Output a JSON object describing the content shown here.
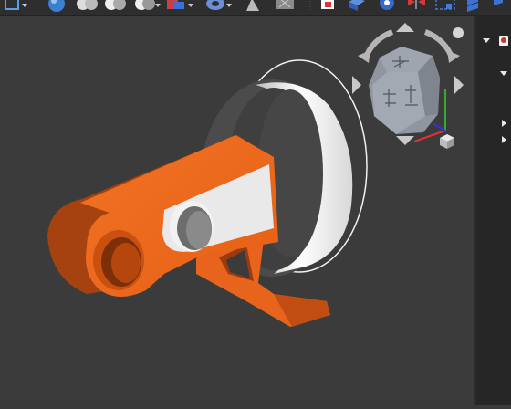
{
  "toolbar": {
    "icons": [
      "select-box-icon",
      "sphere-icon",
      "boolean-union-icon",
      "boolean-cut-icon",
      "boolean-intersect-icon",
      "sweep-icon",
      "torus-icon",
      "cone-icon",
      "box-mesh-icon",
      "clipboard-icon",
      "extrude-icon",
      "revolve-icon",
      "mirror-icon",
      "section-icon",
      "stack-icon"
    ]
  },
  "viewport": {
    "background": "#3b3b3b",
    "part_colors": {
      "arm": "#e8631c",
      "arm_shadow": "#a5420f",
      "disc": "#f0f0f0",
      "disc_shadow": "#4a4a4a"
    }
  },
  "navcube": {
    "faces": [
      "top-face",
      "front-face",
      "right-face"
    ],
    "axes": {
      "x": "#d33",
      "y": "#3a3",
      "z": "#33d"
    }
  },
  "tree": {
    "rows": [
      {
        "icon": "document-icon",
        "expanded": true
      },
      {
        "icon": "",
        "expanded": true
      },
      {
        "icon": "",
        "expanded": false
      },
      {
        "icon": "",
        "expanded": false
      }
    ]
  }
}
